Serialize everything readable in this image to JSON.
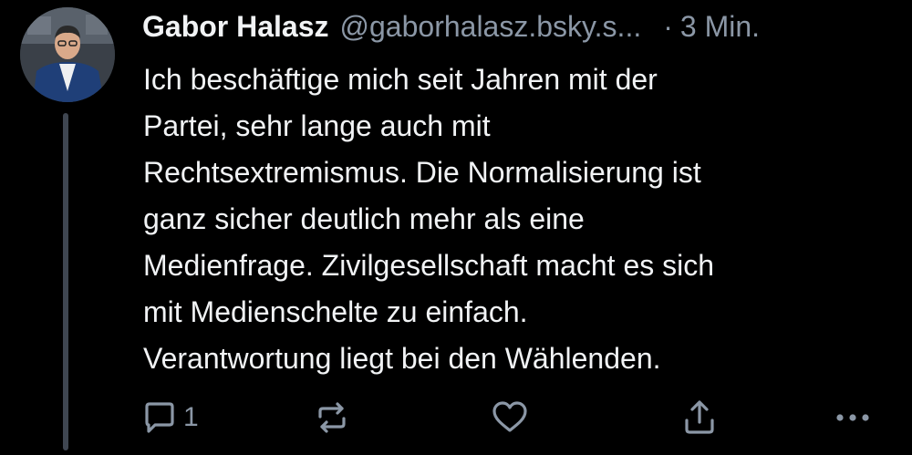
{
  "post": {
    "author": {
      "display_name": "Gabor Halasz",
      "handle": "@gaborhalasz.bsky.s...",
      "avatar_icon": "avatar-photo"
    },
    "separator": "·",
    "timestamp": "3 Min.",
    "text": "Ich beschäftige mich seit Jahren mit der\nPartei, sehr lange auch mit\nRechtsextremismus. Die Normalisierung ist\nganz sicher deutlich mehr als eine\nMedienfrage. Zivilgesellschaft macht es sich\nmit Medienschelte zu einfach.\nVerantwortung liegt bei den Wählenden.",
    "actions": {
      "reply": {
        "icon": "reply-icon",
        "count": "1"
      },
      "repost": {
        "icon": "repost-icon"
      },
      "like": {
        "icon": "heart-icon"
      },
      "share": {
        "icon": "share-icon"
      },
      "more": {
        "icon": "more-icon"
      }
    }
  },
  "colors": {
    "background": "#000000",
    "text": "#f1f3f5",
    "muted": "#8b97a6",
    "thread_line": "#3f4651"
  }
}
